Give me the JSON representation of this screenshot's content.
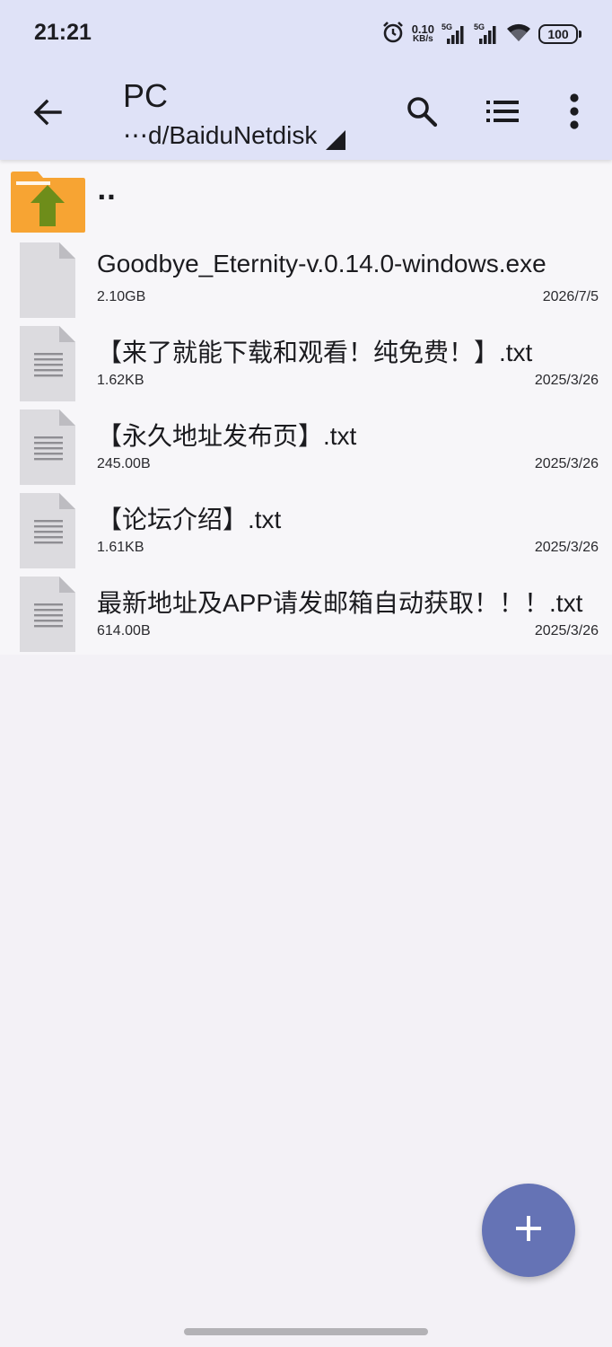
{
  "status_bar": {
    "time": "21:21",
    "net_speed_value": "0.10",
    "net_speed_unit": "KB/s",
    "signal1_label": "5G",
    "signal2_label": "5G",
    "battery": "100"
  },
  "app_bar": {
    "title": "PC",
    "path": "⋯d/BaiduNetdisk"
  },
  "parent_folder": {
    "label": ".."
  },
  "files": [
    {
      "name": "Goodbye_Eternity-v.0.14.0-windows.exe",
      "size": "2.10GB",
      "date": "2026/7/5",
      "type": "generic"
    },
    {
      "name": "【来了就能下载和观看！纯免费！】.txt",
      "size": "1.62KB",
      "date": "2025/3/26",
      "type": "text"
    },
    {
      "name": "【永久地址发布页】.txt",
      "size": "245.00B",
      "date": "2025/3/26",
      "type": "text"
    },
    {
      "name": "【论坛介绍】.txt",
      "size": "1.61KB",
      "date": "2025/3/26",
      "type": "text"
    },
    {
      "name": "最新地址及APP请发邮箱自动获取！！！.txt",
      "size": "614.00B",
      "date": "2025/3/26",
      "type": "text"
    }
  ],
  "icons": {
    "back": "arrow-left-icon",
    "search": "search-icon",
    "view_mode": "list-view-icon",
    "more": "more-vertical-icon",
    "fab": "plus-icon"
  },
  "colors": {
    "header_bg": "#dfe2f7",
    "list_bg": "#f7f6f9",
    "fab_bg": "#6573b5",
    "folder": "#f7a433",
    "folder_arrow": "#6e8d1a"
  }
}
